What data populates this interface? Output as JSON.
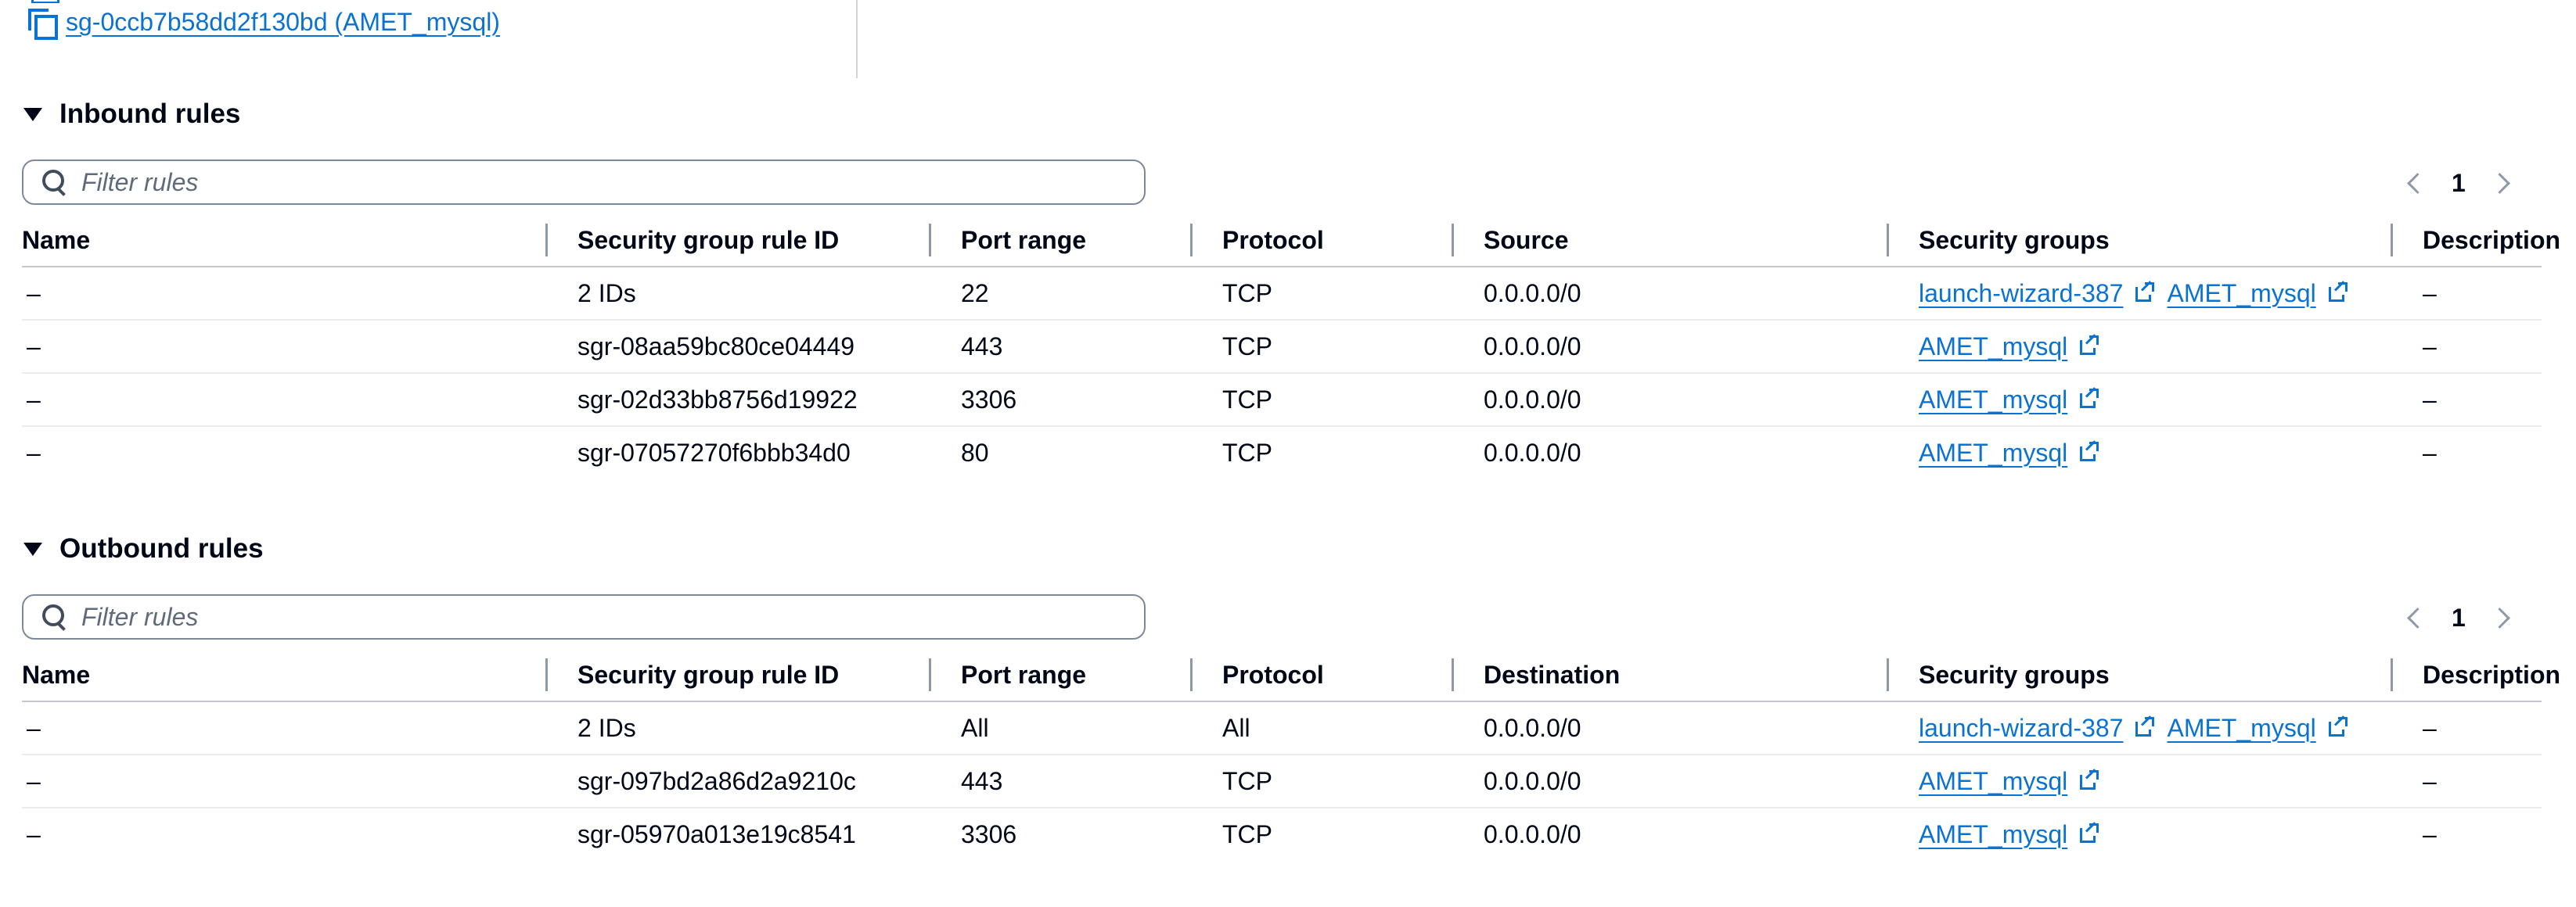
{
  "top": {
    "sg_link": "sg-0ccb7b58dd2f130bd (AMET_mysql)"
  },
  "inbound": {
    "title": "Inbound rules",
    "filter_placeholder": "Filter rules",
    "page": "1",
    "columns": [
      "Name",
      "Security group rule ID",
      "Port range",
      "Protocol",
      "Source",
      "Security groups",
      "Description"
    ],
    "rows": [
      {
        "name": "–",
        "rule_id": "2 IDs",
        "port": "22",
        "protocol": "TCP",
        "source": "0.0.0.0/0",
        "groups": [
          "launch-wizard-387",
          "AMET_mysql"
        ],
        "description": "–"
      },
      {
        "name": "–",
        "rule_id": "sgr-08aa59bc80ce04449",
        "port": "443",
        "protocol": "TCP",
        "source": "0.0.0.0/0",
        "groups": [
          "AMET_mysql"
        ],
        "description": "–"
      },
      {
        "name": "–",
        "rule_id": "sgr-02d33bb8756d19922",
        "port": "3306",
        "protocol": "TCP",
        "source": "0.0.0.0/0",
        "groups": [
          "AMET_mysql"
        ],
        "description": "–"
      },
      {
        "name": "–",
        "rule_id": "sgr-07057270f6bbb34d0",
        "port": "80",
        "protocol": "TCP",
        "source": "0.0.0.0/0",
        "groups": [
          "AMET_mysql"
        ],
        "description": "–"
      }
    ]
  },
  "outbound": {
    "title": "Outbound rules",
    "filter_placeholder": "Filter rules",
    "page": "1",
    "columns": [
      "Name",
      "Security group rule ID",
      "Port range",
      "Protocol",
      "Destination",
      "Security groups",
      "Description"
    ],
    "rows": [
      {
        "name": "–",
        "rule_id": "2 IDs",
        "port": "All",
        "protocol": "All",
        "source": "0.0.0.0/0",
        "groups": [
          "launch-wizard-387",
          "AMET_mysql"
        ],
        "description": "–"
      },
      {
        "name": "–",
        "rule_id": "sgr-097bd2a86d2a9210c",
        "port": "443",
        "protocol": "TCP",
        "source": "0.0.0.0/0",
        "groups": [
          "AMET_mysql"
        ],
        "description": "–"
      },
      {
        "name": "–",
        "rule_id": "sgr-05970a013e19c8541",
        "port": "3306",
        "protocol": "TCP",
        "source": "0.0.0.0/0",
        "groups": [
          "AMET_mysql"
        ],
        "description": "–"
      }
    ]
  },
  "colors": {
    "link": "#0972d3",
    "text": "#000716",
    "border": "#7d8998"
  }
}
